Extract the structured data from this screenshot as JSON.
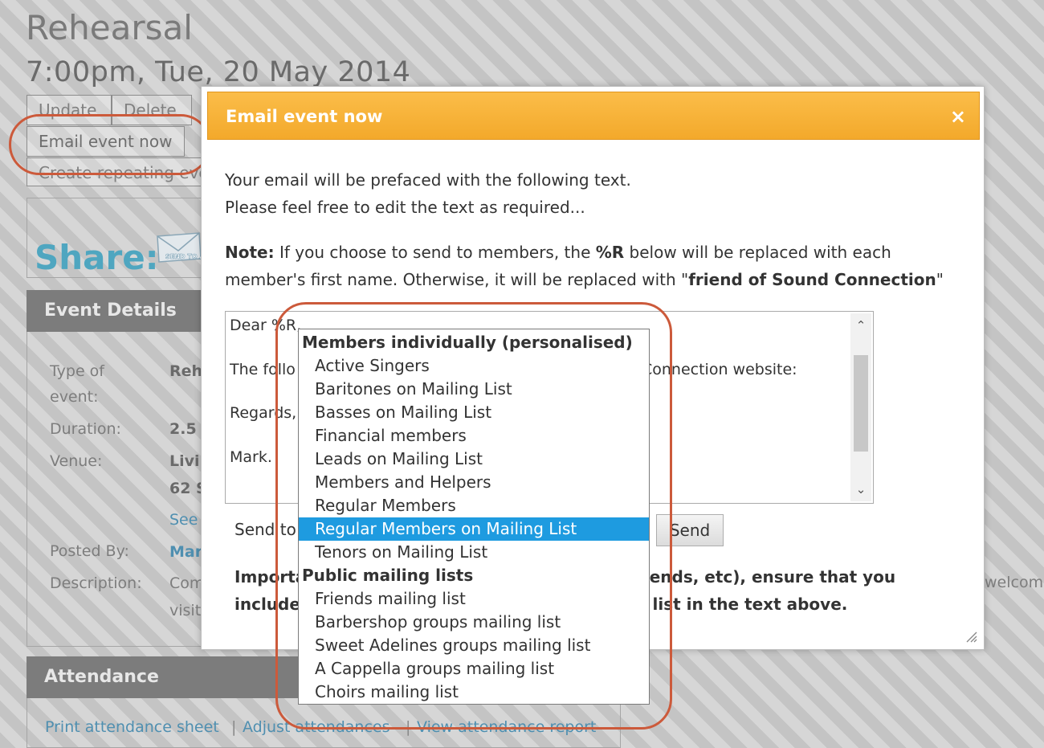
{
  "background": {
    "event_title": "Rehearsal",
    "event_datetime": "7:00pm, Tue, 20 May 2014",
    "buttons": {
      "update": "Update",
      "delete": "Delete",
      "email_event_now": "Email event now",
      "create_repeating": "Create repeating events"
    },
    "share_label": "Share:",
    "share_icon_text": "SEND TO A FRIEND",
    "event_details_header": "Event Details",
    "details": {
      "type_label": "Type of event:",
      "type_value": "Rehearsal",
      "duration_label": "Duration:",
      "duration_value": "2.5 hours",
      "venue_label": "Venue:",
      "venue_value_1": "Living",
      "venue_value_2": "62 S",
      "see_map": "See",
      "posted_by_label": "Posted By:",
      "posted_by_value": "Mark",
      "description_label": "Description:",
      "description_value_1": "Come",
      "description_value_2": "visit",
      "welcome_fragment": "welcom"
    },
    "attendance_header": "Attendance",
    "attendance_links": {
      "print": "Print attendance sheet",
      "separator": "|",
      "adjust": "Adjust attendances",
      "view": "View attendance report"
    }
  },
  "modal": {
    "title": "Email event now",
    "close_glyph": "×",
    "intro_line_1": "Your email will be prefaced with the following text.",
    "intro_line_2": "Please feel free to edit the text as required...",
    "note_label": "Note:",
    "note_line_1": " If you choose to send to members, the ",
    "note_code": "%R",
    "note_line_1_end": " below will be replaced with each",
    "note_line_2": "member's first name. Otherwise, it will be replaced with \"",
    "note_friend": "friend of Sound Connection",
    "note_line_2_end": "\"",
    "textarea": {
      "line_dear": "Dear %R,",
      "line_following_start": "The follo",
      "line_following_end": "Connection website:",
      "line_regards": "Regards,",
      "line_name": "Mark."
    },
    "send_to_label": "Send to",
    "send_button": "Send",
    "important_a": "Importa",
    "important_b": "riends, etc), ensure that you",
    "important_c": "include",
    "important_d": "e list in the text above."
  },
  "dropdown": {
    "groups": [
      {
        "label": "Members individually (personalised)",
        "options": [
          "Active Singers",
          "Baritones on Mailing List",
          "Basses on Mailing List",
          "Financial members",
          "Leads on Mailing List",
          "Members and Helpers",
          "Regular Members",
          "Regular Members on Mailing List",
          "Tenors on Mailing List"
        ]
      },
      {
        "label": "Public mailing lists",
        "options": [
          "Friends mailing list",
          "Barbershop groups mailing list",
          "Sweet Adelines groups mailing list",
          "A Cappella groups mailing list",
          "Choirs mailing list"
        ]
      }
    ],
    "selected": "Regular Members on Mailing List"
  },
  "colors": {
    "modal_header": "#f5ad31",
    "selected_option": "#1e9be0",
    "highlight_ring": "#cc5a3b",
    "share_text": "#4fa6c0"
  }
}
